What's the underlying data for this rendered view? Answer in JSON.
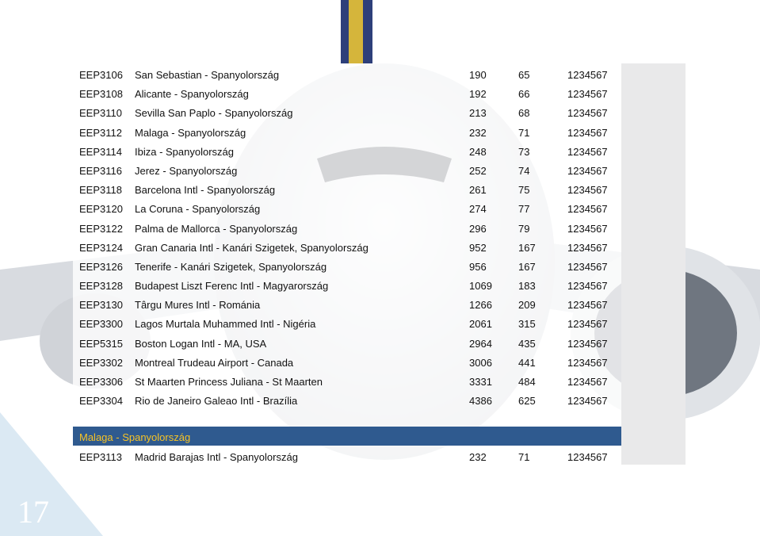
{
  "rows": [
    {
      "code": "EEP3106",
      "dest": "San Sebastian - Spanyolország",
      "dist": "190",
      "time": "65",
      "days": "1234567"
    },
    {
      "code": "EEP3108",
      "dest": "Alicante - Spanyolország",
      "dist": "192",
      "time": "66",
      "days": "1234567"
    },
    {
      "code": "EEP3110",
      "dest": "Sevilla San Paplo - Spanyolország",
      "dist": "213",
      "time": "68",
      "days": "1234567"
    },
    {
      "code": "EEP3112",
      "dest": "Malaga - Spanyolország",
      "dist": "232",
      "time": "71",
      "days": "1234567"
    },
    {
      "code": "EEP3114",
      "dest": "Ibiza - Spanyolország",
      "dist": "248",
      "time": "73",
      "days": "1234567"
    },
    {
      "code": "EEP3116",
      "dest": "Jerez - Spanyolország",
      "dist": "252",
      "time": "74",
      "days": "1234567"
    },
    {
      "code": "EEP3118",
      "dest": "Barcelona Intl - Spanyolország",
      "dist": "261",
      "time": "75",
      "days": "1234567"
    },
    {
      "code": "EEP3120",
      "dest": "La Coruna - Spanyolország",
      "dist": "274",
      "time": "77",
      "days": "1234567"
    },
    {
      "code": "EEP3122",
      "dest": "Palma de Mallorca - Spanyolország",
      "dist": "296",
      "time": "79",
      "days": "1234567"
    },
    {
      "code": "EEP3124",
      "dest": "Gran Canaria Intl - Kanári Szigetek, Spanyolország",
      "dist": "952",
      "time": "167",
      "days": "1234567"
    },
    {
      "code": "EEP3126",
      "dest": "Tenerife - Kanári Szigetek, Spanyolország",
      "dist": "956",
      "time": "167",
      "days": "1234567"
    },
    {
      "code": "EEP3128",
      "dest": "Budapest Liszt Ferenc Intl - Magyarország",
      "dist": "1069",
      "time": "183",
      "days": "1234567"
    },
    {
      "code": "EEP3130",
      "dest": "Târgu Mures Intl - Románia",
      "dist": "1266",
      "time": "209",
      "days": "1234567"
    },
    {
      "code": "EEP3300",
      "dest": "Lagos Murtala Muhammed Intl - Nigéria",
      "dist": "2061",
      "time": "315",
      "days": "1234567"
    },
    {
      "code": "EEP5315",
      "dest": "Boston Logan Intl - MA, USA",
      "dist": "2964",
      "time": "435",
      "days": "1234567"
    },
    {
      "code": "EEP3302",
      "dest": "Montreal Trudeau Airport - Canada",
      "dist": "3006",
      "time": "441",
      "days": "1234567"
    },
    {
      "code": "EEP3306",
      "dest": "St Maarten Princess Juliana - St Maarten",
      "dist": "3331",
      "time": "484",
      "days": "1234567"
    },
    {
      "code": "EEP3304",
      "dest": "Rio de Janeiro Galeao Intl - Brazília",
      "dist": "4386",
      "time": "625",
      "days": "1234567"
    }
  ],
  "section": {
    "title": "Malaga - Spanyolország",
    "row": {
      "code": "EEP3113",
      "dest": "Madrid Barajas Intl - Spanyolország",
      "dist": "232",
      "time": "71",
      "days": "1234567"
    }
  },
  "page_number": "17",
  "colors": {
    "section_bar": "#2f5a8f",
    "section_title": "#f7c325",
    "corner": "#dbe9f3"
  }
}
